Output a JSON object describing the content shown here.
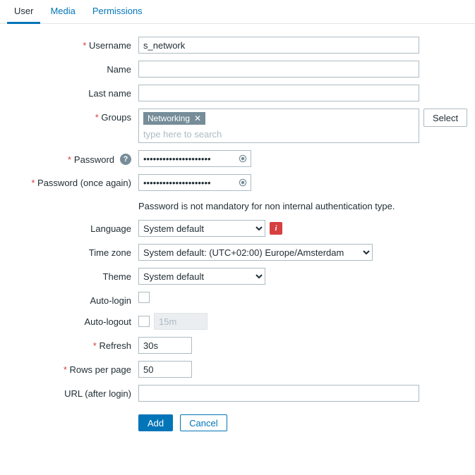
{
  "tabs": {
    "user": "User",
    "media": "Media",
    "permissions": "Permissions"
  },
  "labels": {
    "username": "Username",
    "name": "Name",
    "lastname": "Last name",
    "groups": "Groups",
    "password": "Password",
    "password2": "Password (once again)",
    "language": "Language",
    "timezone": "Time zone",
    "theme": "Theme",
    "autologin": "Auto-login",
    "autologout": "Auto-logout",
    "refresh": "Refresh",
    "rows": "Rows per page",
    "url": "URL (after login)"
  },
  "values": {
    "username": "s_network",
    "name": "",
    "lastname": "",
    "password": "•••••••••••••••••••••",
    "password2": "•••••••••••••••••••••",
    "language": "System default",
    "timezone": "System default: (UTC+02:00) Europe/Amsterdam",
    "theme": "System default",
    "autologout_value": "15m",
    "refresh": "30s",
    "rows": "50",
    "url": ""
  },
  "groups": {
    "selected": [
      {
        "name": "Networking"
      }
    ],
    "placeholder": "type here to search",
    "select_btn": "Select"
  },
  "hint": "Password is not mandatory for non internal authentication type.",
  "buttons": {
    "add": "Add",
    "cancel": "Cancel"
  },
  "icons": {
    "help": "?",
    "info": "i",
    "remove": "✕"
  }
}
